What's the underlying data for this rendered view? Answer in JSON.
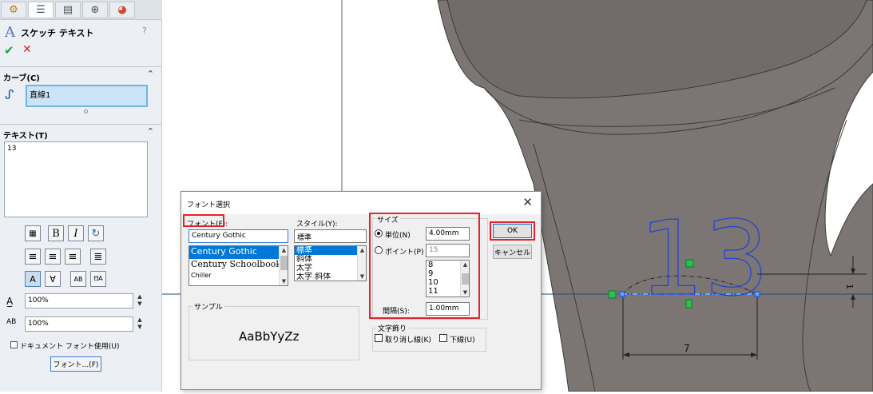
{
  "property_manager": {
    "tabs": [
      "feature-manager-icon",
      "property-manager-icon",
      "configuration-manager-icon",
      "dimxpert-icon",
      "display-manager-icon"
    ],
    "title": "スケッチ テキスト",
    "help": "?",
    "curve_section": {
      "label": "カーブ(C)",
      "value": "直線1"
    },
    "text_section": {
      "label": "テキスト(T)",
      "value": "13"
    },
    "width_factor": "100%",
    "spacing_factor": "100%",
    "use_document_font_label": "ドキュメント フォント使用(U)",
    "font_button_label": "フォント...(F)"
  },
  "font_dialog": {
    "title": "フォント選択",
    "close": "✕",
    "font_label": "フォント(F):",
    "font_value": "Century Gothic",
    "font_list": [
      "Century Gothic",
      "Century Schoolbook",
      "Chiller"
    ],
    "style_label": "スタイル(Y):",
    "style_value": "標準",
    "style_list": [
      "標準",
      "斜体",
      "太字",
      "太字 斜体"
    ],
    "size_group_label": "サイズ",
    "units_label": "単位(N)",
    "units_value": "4.00mm",
    "points_label": "ポイント(P)",
    "points_value": "15",
    "points_list": [
      "8",
      "9",
      "10",
      "11"
    ],
    "spacing_label": "間隔(S):",
    "spacing_value": "1.00mm",
    "ok_label": "OK",
    "cancel_label": "キャンセル",
    "sample_label": "サンプル",
    "sample_text": "AaBbYyZz",
    "effects_label": "文字飾り",
    "strikeout_label": "取り消し線(K)",
    "underline_label": "下線(U)"
  },
  "graphics": {
    "sketch_text": "13",
    "dim_height": "1",
    "dim_width": "7"
  },
  "colors": {
    "highlight_red": "#e8202a",
    "selection_blue": "#0078d7",
    "sketch_blue": "#1f3fd6",
    "model_gray": "#7b7674"
  }
}
